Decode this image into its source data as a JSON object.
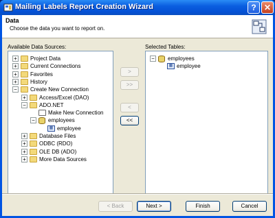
{
  "window": {
    "title": "Mailing Labels Report Creation Wizard",
    "help_glyph": "?",
    "close_glyph": "✕"
  },
  "header": {
    "title": "Data",
    "subtitle": "Choose the data you want to report on."
  },
  "available": {
    "label": "Available Data Sources:",
    "tree": [
      {
        "label": "Project Data",
        "pm": "+",
        "icon": "folder-icon"
      },
      {
        "label": "Current Connections",
        "pm": "+",
        "icon": "folder-icon"
      },
      {
        "label": "Favorites",
        "pm": "+",
        "icon": "folder-icon"
      },
      {
        "label": "History",
        "pm": "+",
        "icon": "folder-icon"
      },
      {
        "label": "Create New Connection",
        "pm": "−",
        "icon": "folder-icon"
      },
      {
        "label": "Access/Excel (DAO)",
        "pm": "+",
        "icon": "folder-icon"
      },
      {
        "label": "ADO.NET",
        "pm": "−",
        "icon": "folder-icon"
      },
      {
        "label": "Make New Connection",
        "pm": "",
        "icon": "wand-icon"
      },
      {
        "label": "employees",
        "pm": "−",
        "icon": "database-icon"
      },
      {
        "label": "employee",
        "pm": "",
        "icon": "table-icon"
      },
      {
        "label": "Database Files",
        "pm": "+",
        "icon": "folder-icon"
      },
      {
        "label": "ODBC (RDO)",
        "pm": "+",
        "icon": "folder-icon"
      },
      {
        "label": "OLE DB (ADO)",
        "pm": "+",
        "icon": "folder-icon"
      },
      {
        "label": "More Data Sources",
        "pm": "+",
        "icon": "folder-icon"
      }
    ]
  },
  "selected": {
    "label": "Selected Tables:",
    "tree": [
      {
        "label": "employees",
        "pm": "−",
        "icon": "database-icon"
      },
      {
        "label": "employee",
        "pm": "",
        "icon": "table-icon"
      }
    ]
  },
  "transfer": {
    "add_one": ">",
    "add_all": ">>",
    "remove_one": "<",
    "remove_all": "<<"
  },
  "footer": {
    "back": "< Back",
    "next": "Next >",
    "finish": "Finish",
    "cancel": "Cancel"
  }
}
